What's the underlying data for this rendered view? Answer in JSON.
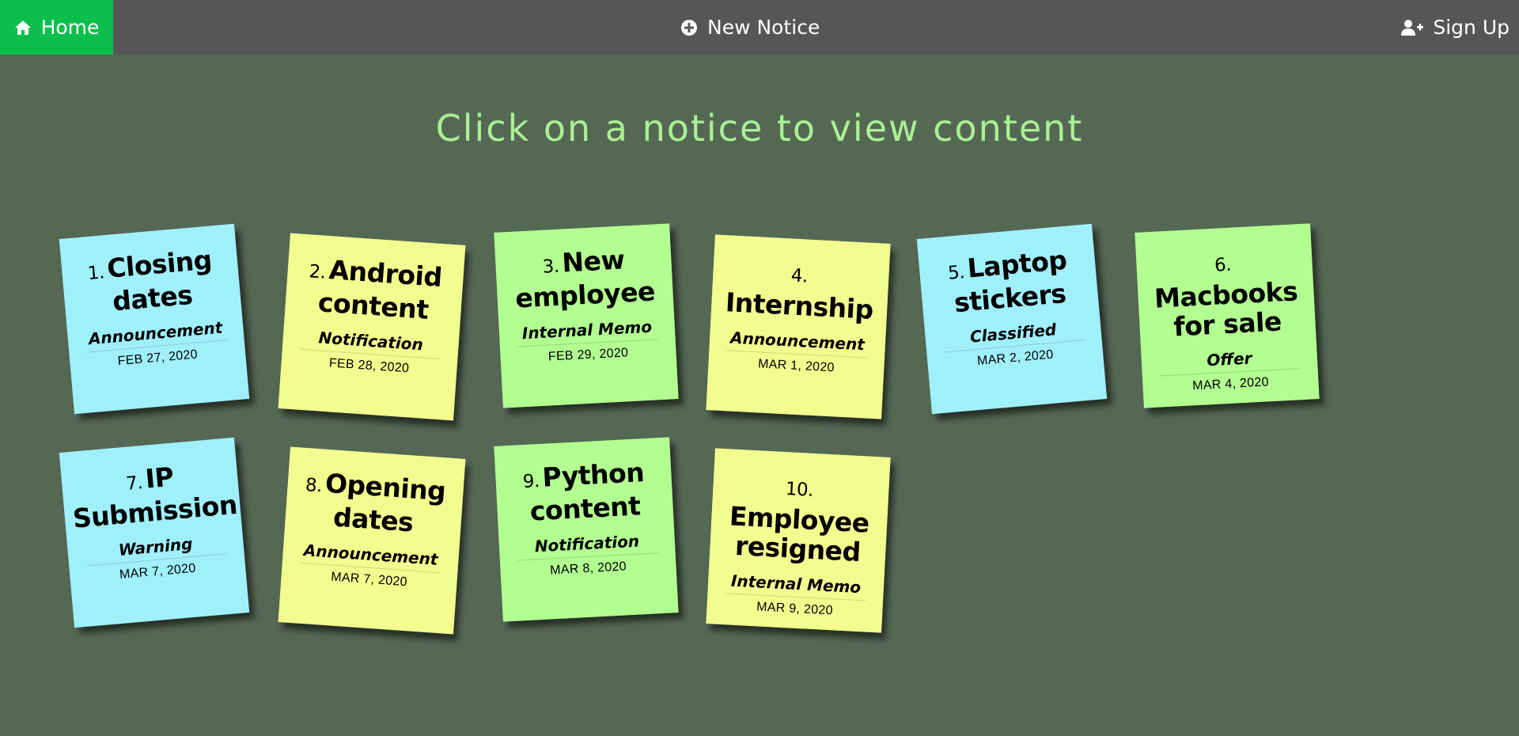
{
  "nav": {
    "home_label": "Home",
    "new_notice_label": "New Notice",
    "signup_label": "Sign Up"
  },
  "heading": "Click on a notice to view content",
  "colors": {
    "background": "#556854",
    "navbar": "#565656",
    "home_accent": "#0cbf4d",
    "heading": "#a9f194",
    "note_blue": "#a0f0fc",
    "note_yellow": "#f2fd8f",
    "note_green": "#b2fe91"
  },
  "notices": [
    {
      "num": "1.",
      "title": "Closing dates",
      "category": "Announcement",
      "date": "FEB 27, 2020",
      "color": "blue"
    },
    {
      "num": "2.",
      "title": "Android content",
      "category": "Notification",
      "date": "FEB 28, 2020",
      "color": "yellow"
    },
    {
      "num": "3.",
      "title": "New employee",
      "category": "Internal Memo",
      "date": "FEB 29, 2020",
      "color": "green"
    },
    {
      "num": "4.",
      "title": "Internship",
      "category": "Announcement",
      "date": "MAR 1, 2020",
      "color": "yellow"
    },
    {
      "num": "5.",
      "title": "Laptop stickers",
      "category": "Classified",
      "date": "MAR 2, 2020",
      "color": "blue"
    },
    {
      "num": "6.",
      "title": "Macbooks for sale",
      "category": "Offer",
      "date": "MAR 4, 2020",
      "color": "green"
    },
    {
      "num": "7.",
      "title": "IP Submission",
      "category": "Warning",
      "date": "MAR 7, 2020",
      "color": "blue"
    },
    {
      "num": "8.",
      "title": "Opening dates",
      "category": "Announcement",
      "date": "MAR 7, 2020",
      "color": "yellow"
    },
    {
      "num": "9.",
      "title": "Python content",
      "category": "Notification",
      "date": "MAR 8, 2020",
      "color": "green"
    },
    {
      "num": "10.",
      "title": "Employee resigned",
      "category": "Internal Memo",
      "date": "MAR 9, 2020",
      "color": "yellow"
    }
  ]
}
